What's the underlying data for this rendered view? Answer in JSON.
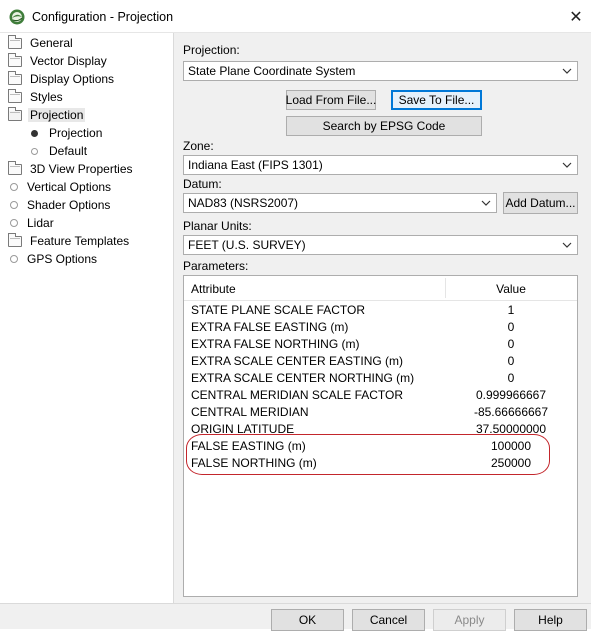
{
  "window": {
    "title": "Configuration - Projection",
    "close_glyph": "✕"
  },
  "nav": {
    "items": [
      {
        "label": "General",
        "icon": "folder-icon"
      },
      {
        "label": "Vector Display",
        "icon": "folder-icon"
      },
      {
        "label": "Display Options",
        "icon": "folder-icon"
      },
      {
        "label": "Styles",
        "icon": "folder-icon"
      },
      {
        "label": "Projection",
        "icon": "folder-open-icon",
        "selected": true
      },
      {
        "label": "Projection",
        "icon": "bullet-filled-icon",
        "child": true
      },
      {
        "label": "Default",
        "icon": "bullet-empty-icon",
        "child": true
      },
      {
        "label": "3D View Properties",
        "icon": "folder-icon"
      },
      {
        "label": "Vertical Options",
        "icon": "bullet-empty-icon"
      },
      {
        "label": "Shader Options",
        "icon": "bullet-empty-icon"
      },
      {
        "label": "Lidar",
        "icon": "bullet-empty-icon"
      },
      {
        "label": "Feature Templates",
        "icon": "folder-icon"
      },
      {
        "label": "GPS Options",
        "icon": "bullet-empty-icon"
      }
    ]
  },
  "projection": {
    "label": "Projection:",
    "value": "State Plane Coordinate System",
    "load_button": "Load From File...",
    "save_button": "Save To File...",
    "epsg_button": "Search by EPSG Code"
  },
  "zone": {
    "label": "Zone:",
    "value": "Indiana East (FIPS 1301)"
  },
  "datum": {
    "label": "Datum:",
    "value": "NAD83 (NSRS2007)",
    "add_button": "Add Datum..."
  },
  "units": {
    "label": "Planar Units:",
    "value": "FEET (U.S. SURVEY)"
  },
  "parameters": {
    "label": "Parameters:",
    "columns": {
      "attribute": "Attribute",
      "value": "Value"
    },
    "rows": [
      {
        "attribute": "STATE PLANE SCALE FACTOR",
        "value": "1"
      },
      {
        "attribute": "EXTRA FALSE EASTING (m)",
        "value": "0"
      },
      {
        "attribute": "EXTRA FALSE NORTHING (m)",
        "value": "0"
      },
      {
        "attribute": "EXTRA SCALE CENTER EASTING (m)",
        "value": "0"
      },
      {
        "attribute": "EXTRA SCALE CENTER NORTHING (m)",
        "value": "0"
      },
      {
        "attribute": "CENTRAL MERIDIAN SCALE FACTOR",
        "value": "0.999966667"
      },
      {
        "attribute": "CENTRAL MERIDIAN",
        "value": "-85.66666667"
      },
      {
        "attribute": "ORIGIN LATITUDE",
        "value": "37.50000000"
      },
      {
        "attribute": "FALSE EASTING (m)",
        "value": "100000"
      },
      {
        "attribute": "FALSE NORTHING (m)",
        "value": "250000"
      }
    ]
  },
  "footer": {
    "ok": "OK",
    "cancel": "Cancel",
    "apply": "Apply",
    "help": "Help"
  },
  "colors": {
    "annotation": "#c3262c",
    "focus": "#0078d7",
    "panel": "#f0f0f0"
  }
}
